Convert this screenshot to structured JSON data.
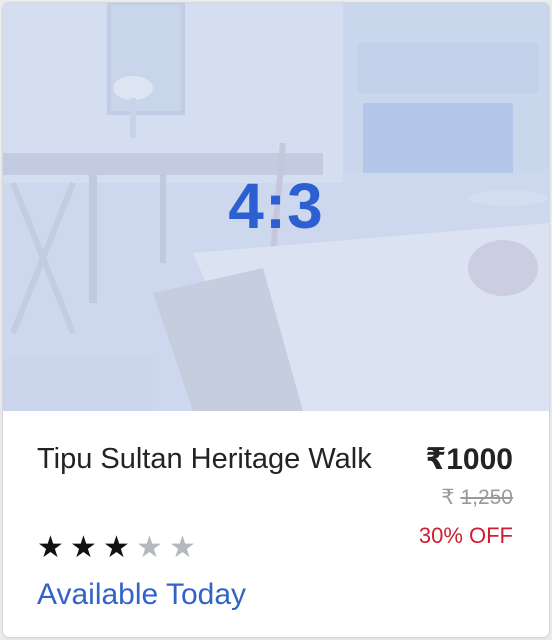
{
  "card": {
    "image": {
      "ratio_label": "4:3",
      "icon": "hotel-room-photo-icon"
    },
    "title": "Tipu Sultan Heritage Walk",
    "price": {
      "currency": "₹",
      "current": "1000",
      "original_currency": "₹",
      "original": "1,250",
      "discount": "30% OFF"
    },
    "rating": {
      "value": 3,
      "max": 5,
      "filled_icon": "★",
      "empty_icon": "★"
    },
    "availability": "Available Today"
  },
  "colors": {
    "accent": "#3163c9",
    "discount": "#cf1f2e",
    "image_overlay": "#cfd9ee"
  }
}
